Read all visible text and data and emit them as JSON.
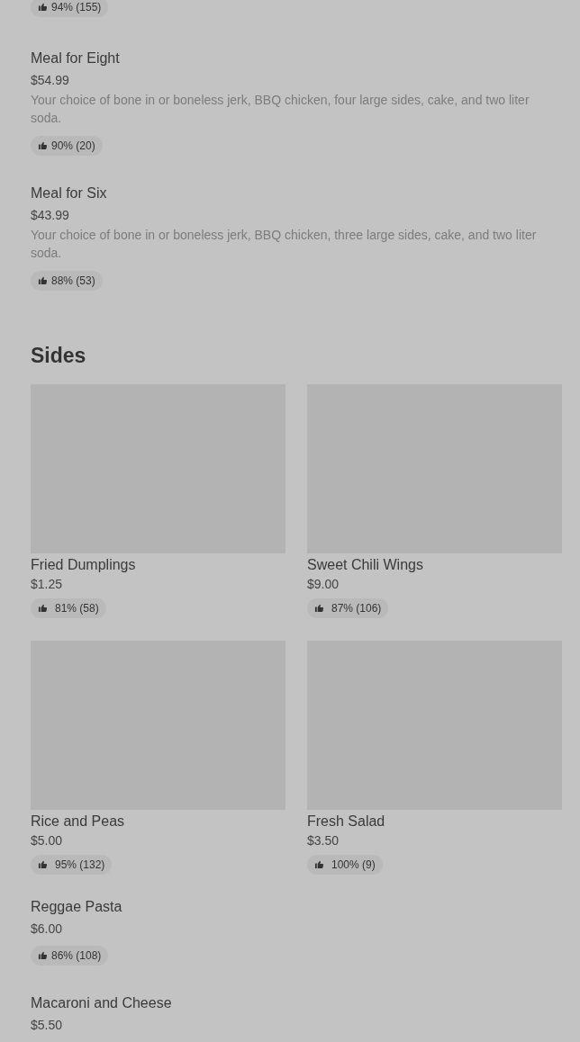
{
  "top_rating": "94% (155)",
  "meals": [
    {
      "name": "Meal for Eight",
      "price": "$54.99",
      "description": "Your choice of bone in or boneless jerk, BBQ chicken, four large sides, cake, and two liter soda.",
      "rating": "90% (20)"
    },
    {
      "name": "Meal for Six",
      "price": "$43.99",
      "description": "Your choice of bone in or boneless jerk, BBQ chicken, three large sides, cake, and two liter soda.",
      "rating": "88% (53)"
    }
  ],
  "sides": {
    "title": "Sides",
    "cards": [
      {
        "name": "Fried Dumplings",
        "price": "$1.25",
        "rating": "81% (58)"
      },
      {
        "name": "Sweet Chili Wings",
        "price": "$9.00",
        "rating": "87% (106)"
      },
      {
        "name": "Rice and Peas",
        "price": "$5.00",
        "rating": "95% (132)"
      },
      {
        "name": "Fresh Salad",
        "price": "$3.50",
        "rating": "100% (9)"
      }
    ],
    "rows": [
      {
        "name": "Reggae Pasta",
        "price": "$6.00",
        "rating": "86% (108)"
      },
      {
        "name": "Macaroni and Cheese",
        "price": "$5.50"
      }
    ]
  }
}
